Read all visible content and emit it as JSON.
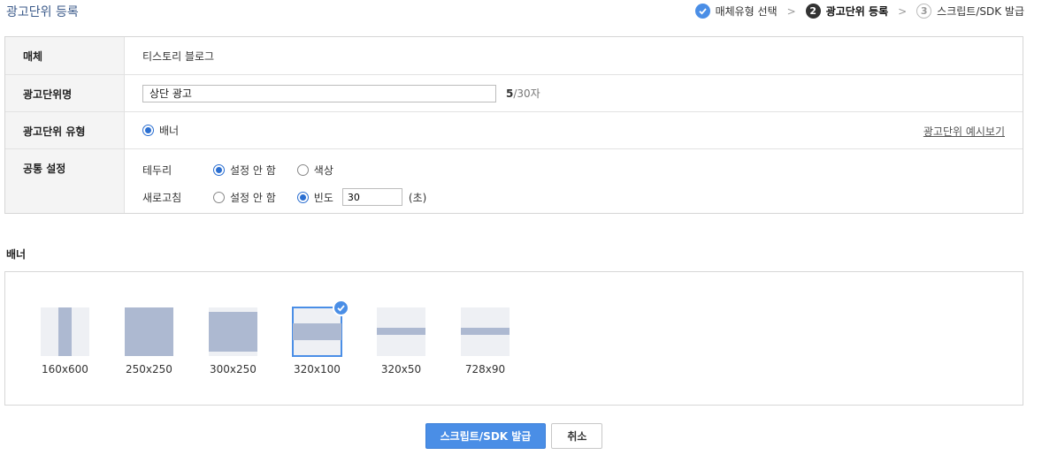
{
  "page": {
    "title": "광고단위 등록"
  },
  "steps": [
    {
      "label": "매체유형 선택",
      "state": "done",
      "marker": "✓"
    },
    {
      "label": "광고단위 등록",
      "state": "active",
      "marker": "2"
    },
    {
      "label": "스크립트/SDK 발급",
      "state": "todo",
      "marker": "3"
    }
  ],
  "step_separator": ">",
  "form": {
    "media": {
      "label": "매체",
      "value": "티스토리 블로그"
    },
    "unit_name": {
      "label": "광고단위명",
      "value": "상단 광고",
      "count_current": "5",
      "count_max": "/30자"
    },
    "unit_type": {
      "label": "광고단위 유형",
      "option": "배너",
      "preview_link": "광고단위 예시보기"
    },
    "common": {
      "label": "공통 설정",
      "border": {
        "label": "테두리",
        "options": [
          "설정 안 함",
          "색상"
        ],
        "selected": "설정 안 함"
      },
      "refresh": {
        "label": "새로고침",
        "options": [
          "설정 안 함",
          "빈도"
        ],
        "selected": "빈도",
        "value": "30",
        "unit": "(초)"
      }
    }
  },
  "banner": {
    "title": "배너",
    "sizes": [
      {
        "label": "160x600",
        "selected": false
      },
      {
        "label": "250x250",
        "selected": false
      },
      {
        "label": "300x250",
        "selected": false
      },
      {
        "label": "320x100",
        "selected": true
      },
      {
        "label": "320x50",
        "selected": false
      },
      {
        "label": "728x90",
        "selected": false
      }
    ]
  },
  "actions": {
    "primary": "스크립트/SDK 발급",
    "cancel": "취소"
  },
  "colors": {
    "accent": "#4a8ee6",
    "title": "#3b5a8a",
    "thumb_fill": "#adb9d1",
    "thumb_bg": "#eef0f4"
  }
}
